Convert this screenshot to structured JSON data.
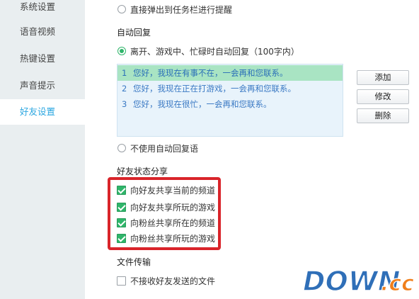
{
  "sidebar": {
    "items": [
      {
        "label": "系统设置"
      },
      {
        "label": "语音视频"
      },
      {
        "label": "热键设置"
      },
      {
        "label": "声音提示"
      },
      {
        "label": "好友设置",
        "active": true
      }
    ]
  },
  "main": {
    "popup_option": {
      "label": "直接弹出到任务栏进行提醒",
      "checked": false
    },
    "auto_reply": {
      "title": "自动回复",
      "enable_option": {
        "label": "离开、游戏中、忙碌时自动回复（100字内）",
        "checked": true
      },
      "messages": [
        {
          "num": "1",
          "text": "您好，我现在有事不在，一会再和您联系。",
          "selected": true
        },
        {
          "num": "2",
          "text": "您好，我现在正在打游戏，一会再和您联系。"
        },
        {
          "num": "3",
          "text": "您好，我现在很忙，一会再和您联系。"
        }
      ],
      "buttons": {
        "add": "添加",
        "edit": "修改",
        "delete": "删除"
      },
      "disable_option": {
        "label": "不使用自动回复语",
        "checked": false
      }
    },
    "status_share": {
      "title": "好友状态分享",
      "options": [
        {
          "label": "向好友共享当前的频道",
          "checked": true
        },
        {
          "label": "向好友共享所玩的游戏",
          "checked": true
        },
        {
          "label": "向粉丝共享所在的频道",
          "checked": true
        },
        {
          "label": "向粉丝共享所玩的游戏",
          "checked": true
        }
      ]
    },
    "file_transfer": {
      "title": "文件传输",
      "option": {
        "label": "不接收好友发送的文件",
        "checked": false
      }
    }
  },
  "watermark": {
    "text_down": "DOWN",
    "text_cc": ".cc"
  },
  "colors": {
    "accent_blue": "#2aa6e0",
    "check_green": "#2fb56a",
    "highlight_red": "#d9242a",
    "sidebar_bg": "#e9eef0",
    "watermark_blue": "#2f6fb8",
    "watermark_orange": "#f07f1b"
  }
}
